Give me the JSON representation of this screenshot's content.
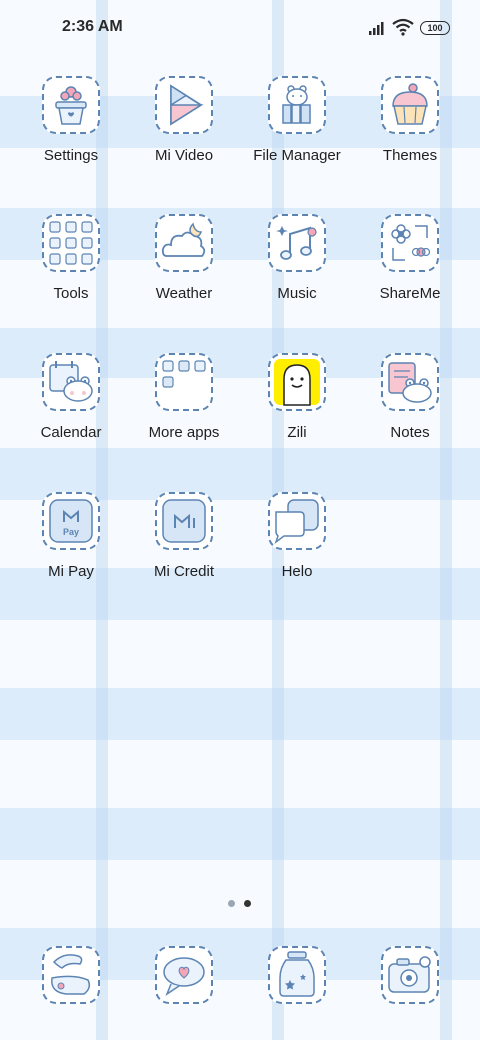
{
  "status_bar": {
    "time": "2:36 AM",
    "battery": "100",
    "icons": [
      "signal-icon",
      "wifi-icon",
      "battery-icon"
    ]
  },
  "apps": [
    {
      "label": "Settings",
      "icon": "flower-pot-icon"
    },
    {
      "label": "Mi Video",
      "icon": "play-triangle-icon"
    },
    {
      "label": "File Manager",
      "icon": "bear-books-icon"
    },
    {
      "label": "Themes",
      "icon": "cupcake-icon"
    },
    {
      "label": "Tools",
      "icon": "tools-folder-icon"
    },
    {
      "label": "Weather",
      "icon": "cloud-moon-icon"
    },
    {
      "label": "Music",
      "icon": "music-note-icon"
    },
    {
      "label": "ShareMe",
      "icon": "flowers-frame-icon"
    },
    {
      "label": "Calendar",
      "icon": "frog-calendar-icon"
    },
    {
      "label": "More apps",
      "icon": "more-apps-folder-icon"
    },
    {
      "label": "Zili",
      "icon": "zili-ghost-icon"
    },
    {
      "label": "Notes",
      "icon": "frog-notes-icon"
    },
    {
      "label": "Mi Pay",
      "icon": "mi-pay-icon"
    },
    {
      "label": "Mi Credit",
      "icon": "mi-credit-icon"
    },
    {
      "label": "Helo",
      "icon": "chat-bubbles-icon"
    }
  ],
  "mi_pay_text": "Pay",
  "pager": {
    "pages": 2,
    "current": 2
  },
  "dock": [
    {
      "icon": "phone-handset-icon"
    },
    {
      "icon": "message-envelope-icon"
    },
    {
      "icon": "star-jar-icon"
    },
    {
      "icon": "camera-icon"
    }
  ],
  "colors": {
    "outline": "#5c84b3",
    "stripe": "#c8e0f6",
    "background": "#f7fbff",
    "zili_yellow": "#ffee00",
    "accent_pink": "#f4a6b8"
  }
}
